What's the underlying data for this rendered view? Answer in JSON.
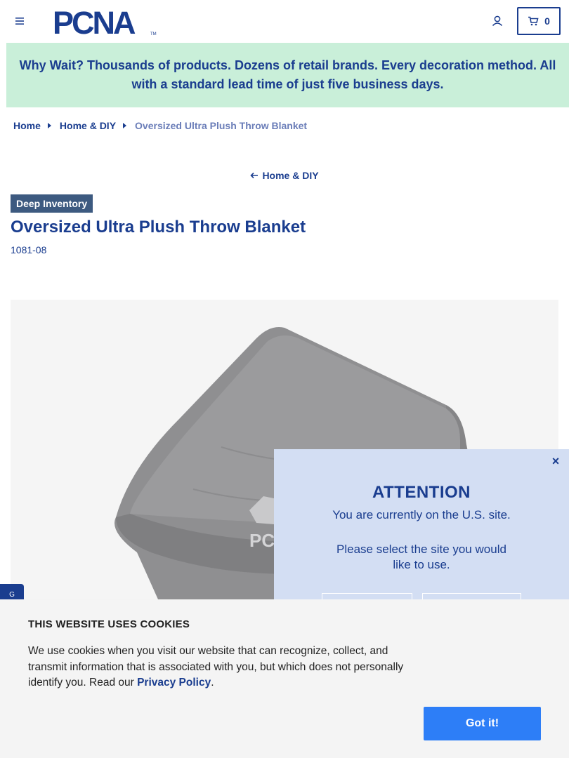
{
  "header": {
    "logo_text": "PCNA",
    "logo_tm": "TM",
    "cart_count": "0"
  },
  "promo": {
    "text": "Why Wait? Thousands of products. Dozens of retail brands. Every decoration method. All with a standard lead time of just five business days."
  },
  "breadcrumb": {
    "items": [
      "Home",
      "Home & DIY"
    ],
    "current": "Oversized Ultra Plush Throw Blanket"
  },
  "back_link": {
    "label": "Home & DIY"
  },
  "product": {
    "badge": "Deep Inventory",
    "title": "Oversized Ultra Plush Throw Blanket",
    "sku": "1081-08",
    "image_imprint": "PCNA"
  },
  "feedback_tab": {
    "label": "G"
  },
  "attention_modal": {
    "title": "ATTENTION",
    "line1": "You are currently on the U.S. site.",
    "line2": "Please select the site you would like to use.",
    "close_glyph": "×"
  },
  "cookie_banner": {
    "title": "THIS WEBSITE USES COOKIES",
    "body": "We use cookies when you visit our website that can recognize, collect, and transmit information that is associated with you, but which does not personally identify you. Read our ",
    "link_label": "Privacy Policy",
    "trailing": ".",
    "button_label": "Got it!"
  },
  "colors": {
    "brand_blue": "#1a3d8f",
    "promo_green": "#c9efd9",
    "modal_bg": "#d3def3",
    "cookie_button": "#2d7ef7",
    "badge_bg": "#3d5a80"
  }
}
